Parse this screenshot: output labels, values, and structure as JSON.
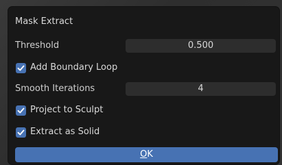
{
  "dialog": {
    "title": "Mask Extract",
    "threshold": {
      "label": "Threshold",
      "value": "0.500"
    },
    "add_boundary_loop": {
      "label": "Add Boundary Loop",
      "checked": true
    },
    "smooth_iterations": {
      "label": "Smooth Iterations",
      "value": "4"
    },
    "project_to_sculpt": {
      "label": "Project to Sculpt",
      "checked": true
    },
    "extract_as_solid": {
      "label": "Extract as Solid",
      "checked": true
    },
    "ok_label": "OK"
  },
  "colors": {
    "accent": "#4772b3",
    "panel": "#181818",
    "field": "#2d2d2d"
  },
  "icons": {
    "check": "checkmark-icon"
  }
}
